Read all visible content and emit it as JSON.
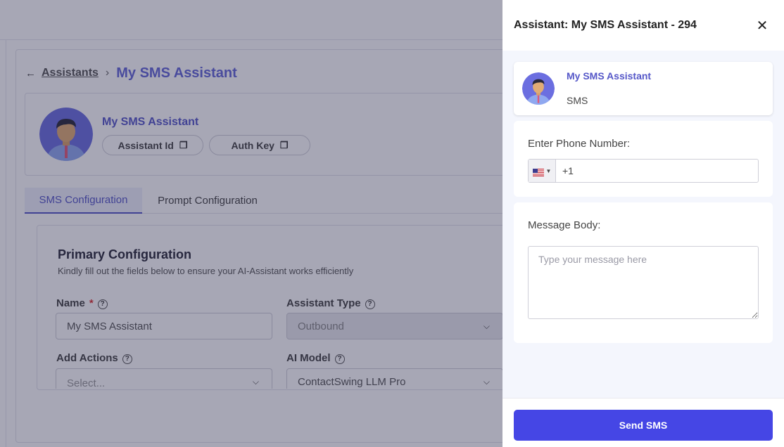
{
  "background": {
    "breadcrumb": {
      "parent": "Assistants",
      "current": "My SMS Assistant"
    },
    "profile": {
      "name": "My SMS Assistant",
      "assistant_id_label": "Assistant Id",
      "auth_key_label": "Auth Key"
    },
    "tabs": [
      {
        "label": "SMS Configuration",
        "active": true
      },
      {
        "label": "Prompt Configuration",
        "active": false
      }
    ],
    "primary_config": {
      "title": "Primary Configuration",
      "subtitle": "Kindly fill out the fields below to ensure your AI-Assistant works efficiently",
      "fields": {
        "name": {
          "label": "Name",
          "required_mark": "*",
          "value": "My SMS Assistant"
        },
        "assistant_type": {
          "label": "Assistant Type",
          "value": "Outbound",
          "disabled": true
        },
        "add_actions": {
          "label": "Add Actions",
          "placeholder": "Select..."
        },
        "ai_model": {
          "label": "AI Model",
          "value": "ContactSwing LLM Pro"
        }
      }
    }
  },
  "drawer": {
    "title": "Assistant: My SMS Assistant - 294",
    "assistant_card": {
      "name": "My SMS Assistant",
      "type": "SMS"
    },
    "phone": {
      "label": "Enter Phone Number:",
      "country_flag": "us-flag-icon",
      "value": "+1"
    },
    "message": {
      "label": "Message Body:",
      "placeholder": "Type your message here"
    },
    "send_label": "Send SMS"
  },
  "colors": {
    "accent": "#5557c8",
    "button": "#4546e5",
    "overlay": "rgba(36,34,70,0.40)",
    "drawer_bg": "#f4f6fd"
  }
}
